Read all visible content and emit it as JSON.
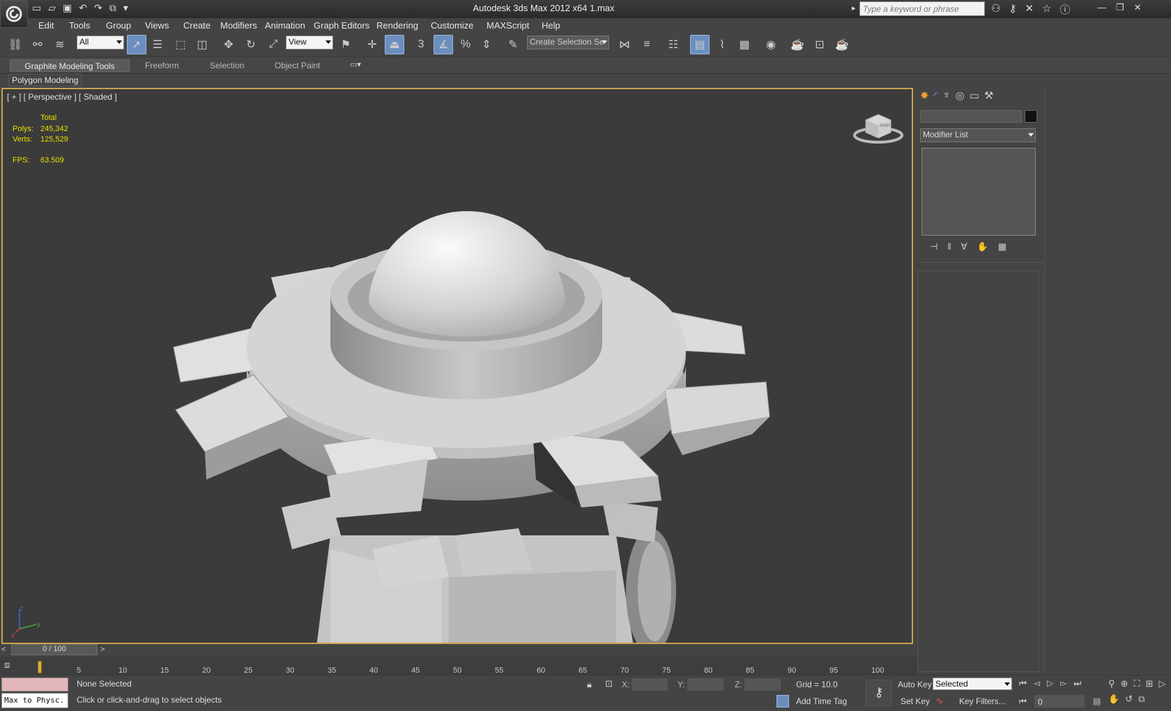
{
  "window": {
    "title": "Autodesk 3ds Max  2012 x64      1.max",
    "search_placeholder": "Type a keyword or phrase"
  },
  "menu": [
    "Edit",
    "Tools",
    "Group",
    "Views",
    "Create",
    "Modifiers",
    "Animation",
    "Graph Editors",
    "Rendering",
    "Customize",
    "MAXScript",
    "Help"
  ],
  "toolbar": {
    "selection_filter": "All",
    "ref_coord": "View",
    "snap_value": "3",
    "named_selection": "Create Selection Se"
  },
  "ribbon": {
    "tabs": [
      "Graphite Modeling Tools",
      "Freeform",
      "Selection",
      "Object Paint"
    ],
    "panel": "Polygon Modeling"
  },
  "viewport": {
    "label": "[ + ] [ Perspective ] [ Shaded ]",
    "stats": {
      "header": "Total",
      "polys_label": "Polys:",
      "polys": "245,342",
      "verts_label": "Verts:",
      "verts": "125,529",
      "fps_label": "FPS:",
      "fps": "63.509"
    },
    "viewcube_label": "RIGHT",
    "axes": {
      "x": "x",
      "y": "y",
      "z": "z"
    }
  },
  "command_panel": {
    "modifier_list": "Modifier List"
  },
  "timeline": {
    "frame_display": "0 / 100",
    "ticks": [
      "5",
      "10",
      "15",
      "20",
      "25",
      "30",
      "35",
      "40",
      "45",
      "50",
      "55",
      "60",
      "65",
      "70",
      "75",
      "80",
      "85",
      "90",
      "95",
      "100"
    ]
  },
  "status": {
    "maxscript": "Max to Physc.",
    "selection": "None Selected",
    "prompt": "Click or click-and-drag to select objects",
    "x_label": "X:",
    "y_label": "Y:",
    "z_label": "Z:",
    "grid": "Grid = 10.0",
    "add_time_tag": "Add Time Tag",
    "auto_key": "Auto Key",
    "set_key": "Set Key",
    "key_mode": "Selected",
    "key_filters": "Key Filters...",
    "current_frame": "0"
  },
  "colors": {
    "viewport_border": "#c8a54a",
    "stats_text": "#e8e000",
    "active_button": "#6a8fbf"
  }
}
